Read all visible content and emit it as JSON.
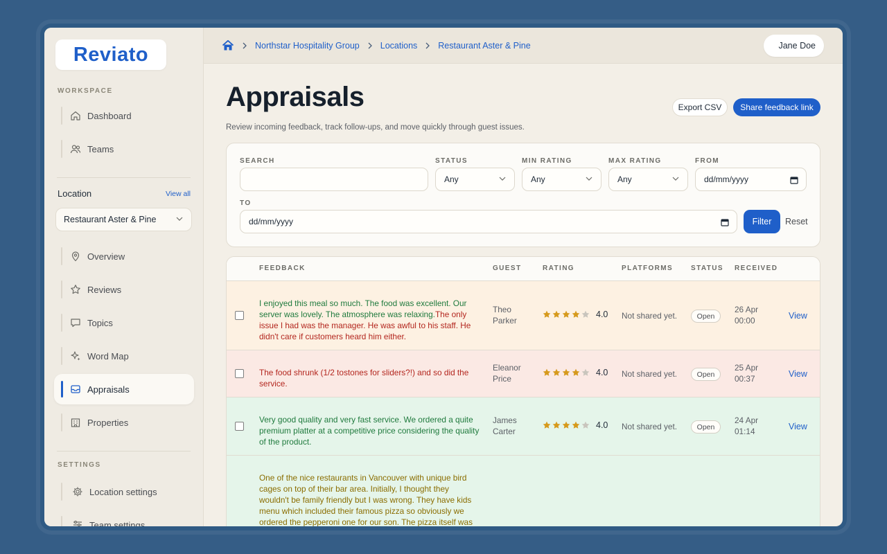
{
  "brand": {
    "name": "Reviato"
  },
  "sidebar": {
    "workspace_label": "WORKSPACE",
    "workspace_items": [
      {
        "label": "Dashboard",
        "icon": "home-icon"
      },
      {
        "label": "Teams",
        "icon": "users-icon"
      }
    ],
    "location_title": "Location",
    "view_all": "View all",
    "location_select": "Restaurant Aster & Pine",
    "location_items": [
      {
        "label": "Overview",
        "icon": "map-pin-icon"
      },
      {
        "label": "Reviews",
        "icon": "star-icon"
      },
      {
        "label": "Topics",
        "icon": "chat-icon"
      },
      {
        "label": "Word Map",
        "icon": "sparkle-icon"
      },
      {
        "label": "Appraisals",
        "icon": "inbox-icon",
        "active": true
      },
      {
        "label": "Properties",
        "icon": "building-icon"
      }
    ],
    "settings_label": "SETTINGS",
    "settings_items": [
      {
        "label": "Location settings",
        "icon": "gear-icon"
      },
      {
        "label": "Team settings",
        "icon": "sliders-icon"
      }
    ]
  },
  "breadcrumb": [
    "Northstar Hospitality Group",
    "Locations",
    "Restaurant Aster & Pine"
  ],
  "user": {
    "name": "Jane Doe"
  },
  "page": {
    "title": "Appraisals",
    "subtitle": "Review incoming feedback, track follow-ups, and move quickly through guest issues.",
    "export_label": "Export CSV",
    "share_label": "Share feedback link"
  },
  "filters": {
    "search_label": "SEARCH",
    "search_value": "",
    "status_label": "STATUS",
    "status_value": "Any",
    "min_rating_label": "MIN RATING",
    "min_rating_value": "Any",
    "max_rating_label": "MAX RATING",
    "max_rating_value": "Any",
    "from_label": "FROM",
    "from_value": "dd/mm/yyyy",
    "to_label": "TO",
    "to_value": "dd/mm/yyyy",
    "filter_button": "Filter",
    "reset_button": "Reset"
  },
  "table": {
    "headers": [
      "FEEDBACK",
      "GUEST",
      "RATING",
      "PLATFORMS",
      "STATUS",
      "RECEIVED"
    ],
    "rows": [
      {
        "segments": [
          {
            "text": "I enjoyed this meal so much. The food was excellent. Our server was lovely. The atmosphere was relaxing.",
            "tone": "positive"
          },
          {
            "text": "The only issue I had was the manager. He was awful to his staff. He didn't care if customers heard him either.",
            "tone": "negative"
          }
        ],
        "guest": [
          "Theo",
          "Parker"
        ],
        "stars": 4,
        "rating": "4.0",
        "platforms": "Not shared yet.",
        "status": "Open",
        "received": [
          "26 Apr",
          "00:00"
        ],
        "action": "View",
        "bg": "#fdf1e2"
      },
      {
        "segments": [
          {
            "text": "The food shrunk (1/2 tostones for sliders?!) and so did the service.",
            "tone": "negative"
          }
        ],
        "guest": [
          "Eleanor",
          "Price"
        ],
        "stars": 4,
        "rating": "4.0",
        "platforms": "Not shared yet.",
        "status": "Open",
        "received": [
          "25 Apr",
          "00:37"
        ],
        "action": "View",
        "bg": "#fbe9e4"
      },
      {
        "segments": [
          {
            "text": "Very good quality and very fast service. We ordered a quite premium platter at a competitive price considering the quality of the product.",
            "tone": "positive"
          }
        ],
        "guest": [
          "James",
          "Carter"
        ],
        "stars": 4,
        "rating": "4.0",
        "platforms": "Not shared yet.",
        "status": "Open",
        "received": [
          "24 Apr",
          "01:14"
        ],
        "action": "View",
        "bg": "#e5f5ea"
      },
      {
        "segments": [
          {
            "text": "One of the nice restaurants in Vancouver with unique bird cages on top of their bar area. Initially, I thought they wouldn't be family friendly but I was wrong. They have kids menu which included their famous pizza so obviously we ordered the pepperoni one for our son. The pizza itself was",
            "tone": "mixed"
          }
        ],
        "guest": [],
        "stars": 0,
        "rating": "",
        "platforms": "",
        "status": "",
        "received": [],
        "action": "",
        "bg": "#e5f5ea"
      }
    ]
  },
  "colors": {
    "accent": "#1f5fc9",
    "positive": "#1f7a3d",
    "negative": "#b3261e",
    "mixed": "#8a6d00",
    "star": "#d69a1d",
    "star_empty": "#c9c5bd"
  }
}
